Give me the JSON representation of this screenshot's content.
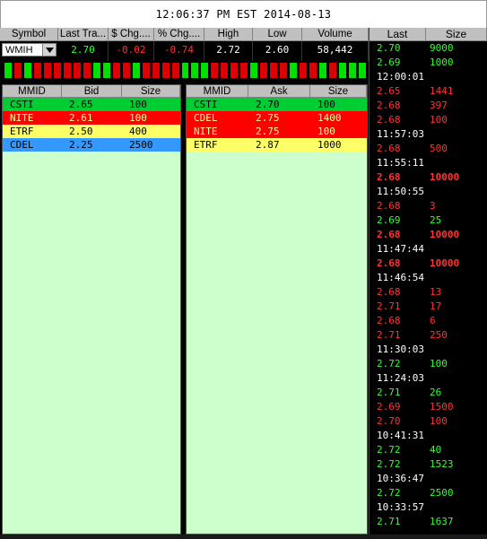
{
  "clock": "12:06:37 PM EST 2014-08-13",
  "quote": {
    "headers": [
      "Symbol",
      "Last Tra...",
      "$ Chg....",
      "% Chg....",
      "High",
      "Low",
      "Volume"
    ],
    "symbol": "WMIH",
    "last": "2.70",
    "chg": "-0.02",
    "pct": "-0.74",
    "high": "2.72",
    "low": "2.60",
    "volume": "58,442"
  },
  "tick_indicators": [
    "green",
    "red",
    "green",
    "red",
    "red",
    "red",
    "red",
    "red",
    "red",
    "green",
    "green",
    "red",
    "red",
    "green",
    "red",
    "red",
    "red",
    "red",
    "green",
    "green",
    "green",
    "red",
    "red",
    "red",
    "red",
    "green",
    "red",
    "red",
    "red",
    "green",
    "red",
    "red",
    "green",
    "red",
    "green",
    "green",
    "green"
  ],
  "bid_book": {
    "headers": [
      "MMID",
      "Bid",
      "Size"
    ],
    "rows": [
      {
        "mmid": "CSTI",
        "price": "2.65",
        "size": "100",
        "color": "#00cc33"
      },
      {
        "mmid": "NITE",
        "price": "2.61",
        "size": "100",
        "color": "#ff0000"
      },
      {
        "mmid": "ETRF",
        "price": "2.50",
        "size": "400",
        "color": "#ffff66"
      },
      {
        "mmid": "CDEL",
        "price": "2.25",
        "size": "2500",
        "color": "#3399ff"
      }
    ]
  },
  "ask_book": {
    "headers": [
      "MMID",
      "Ask",
      "Size"
    ],
    "rows": [
      {
        "mmid": "CSTI",
        "price": "2.70",
        "size": "100",
        "color": "#00cc33"
      },
      {
        "mmid": "CDEL",
        "price": "2.75",
        "size": "1400",
        "color": "#ff0000"
      },
      {
        "mmid": "NITE",
        "price": "2.75",
        "size": "100",
        "color": "#ff0000"
      },
      {
        "mmid": "ETRF",
        "price": "2.87",
        "size": "1000",
        "color": "#ffff66"
      }
    ]
  },
  "tape": {
    "headers": [
      "Last",
      "Size"
    ],
    "rows": [
      {
        "price": "2.70",
        "size": "9000",
        "color": "#33ff33"
      },
      {
        "price": "2.69",
        "size": "1000",
        "color": "#33ff33"
      },
      {
        "time": "12:00:01"
      },
      {
        "price": "2.65",
        "size": "1441",
        "color": "#ff3333"
      },
      {
        "price": "2.68",
        "size": "397",
        "color": "#ff3333"
      },
      {
        "price": "2.68",
        "size": "100",
        "color": "#ff3333"
      },
      {
        "time": "11:57:03"
      },
      {
        "price": "2.68",
        "size": "500",
        "color": "#ff3333"
      },
      {
        "time": "11:55:11"
      },
      {
        "price": "2.68",
        "size": "10000",
        "color": "#ff3333",
        "bold": true
      },
      {
        "time": "11:50:55"
      },
      {
        "price": "2.68",
        "size": "3",
        "color": "#ff3333"
      },
      {
        "price": "2.69",
        "size": "25",
        "color": "#33ff33"
      },
      {
        "price": "2.68",
        "size": "10000",
        "color": "#ff3333",
        "bold": true
      },
      {
        "time": "11:47:44"
      },
      {
        "price": "2.68",
        "size": "10000",
        "color": "#ff3333",
        "bold": true
      },
      {
        "time": "11:46:54"
      },
      {
        "price": "2.68",
        "size": "13",
        "color": "#ff3333"
      },
      {
        "price": "2.71",
        "size": "17",
        "color": "#ff3333"
      },
      {
        "price": "2.68",
        "size": "6",
        "color": "#ff3333"
      },
      {
        "price": "2.71",
        "size": "250",
        "color": "#ff3333"
      },
      {
        "time": "11:30:03"
      },
      {
        "price": "2.72",
        "size": "100",
        "color": "#33ff33"
      },
      {
        "time": "11:24:03"
      },
      {
        "price": "2.71",
        "size": "26",
        "color": "#33ff33"
      },
      {
        "price": "2.69",
        "size": "1500",
        "color": "#ff3333"
      },
      {
        "price": "2.70",
        "size": "100",
        "color": "#ff3333"
      },
      {
        "time": "10:41:31"
      },
      {
        "price": "2.72",
        "size": "40",
        "color": "#33ff33"
      },
      {
        "price": "2.72",
        "size": "1523",
        "color": "#33ff33"
      },
      {
        "time": "10:36:47"
      },
      {
        "price": "2.72",
        "size": "2500",
        "color": "#33ff33"
      },
      {
        "time": "10:33:57"
      },
      {
        "price": "2.71",
        "size": "1637",
        "color": "#33ff33"
      }
    ]
  },
  "colors": {
    "up": "#33ff33",
    "down": "#ff3333",
    "book_bg": "#ccffcc",
    "header_bg": "#c0c0c0"
  }
}
